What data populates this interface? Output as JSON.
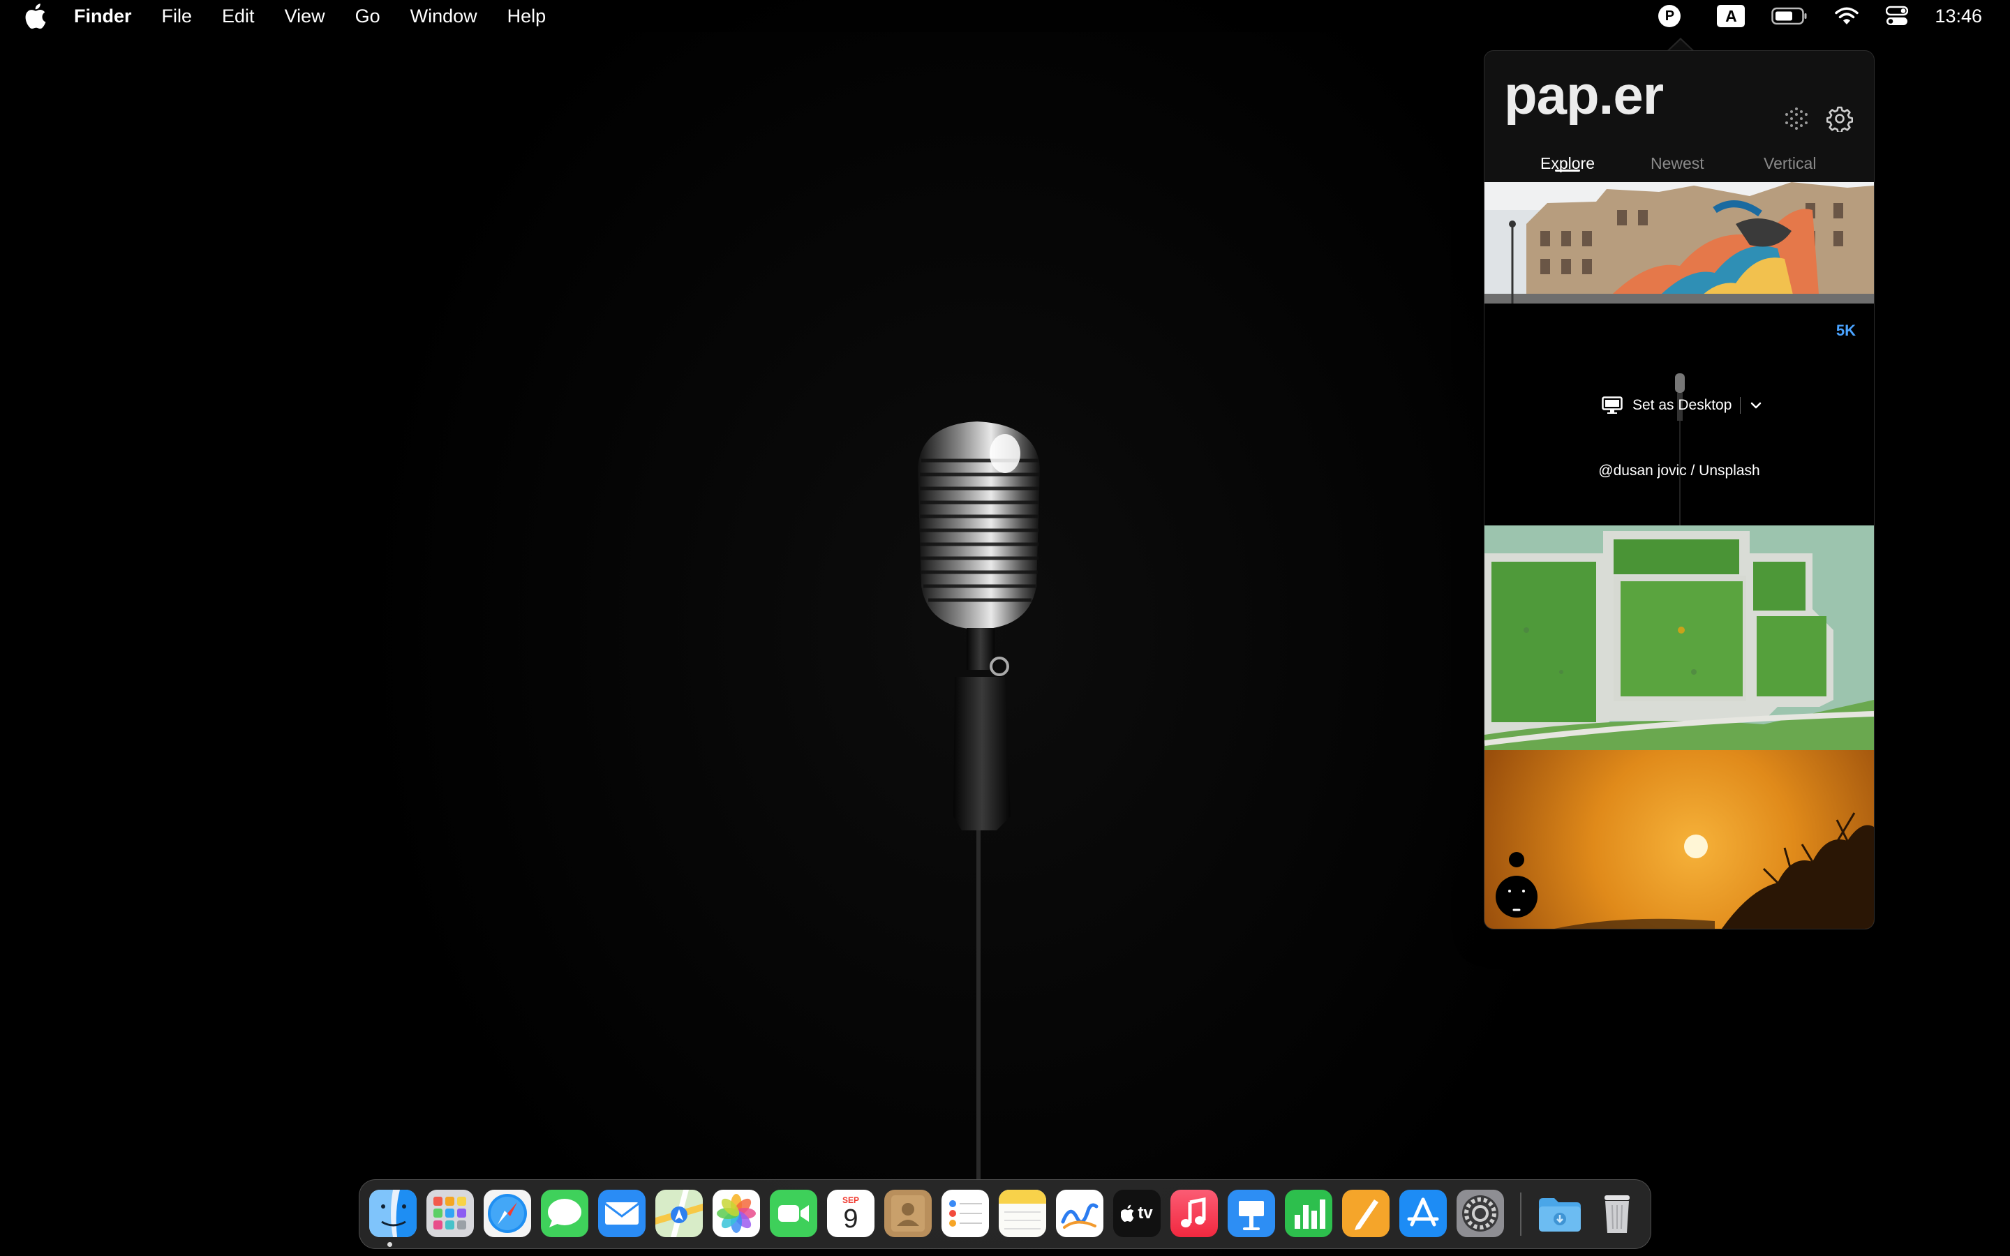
{
  "menubar": {
    "app_name": "Finder",
    "menus": [
      "File",
      "Edit",
      "View",
      "Go",
      "Window",
      "Help"
    ],
    "status": {
      "paper_letter": "P",
      "input_source": "A",
      "time": "13:46"
    },
    "icons": [
      "apple-icon",
      "paper-status-icon",
      "input-source-icon",
      "battery-icon",
      "wifi-icon",
      "control-center-icon"
    ]
  },
  "popover": {
    "logo": "pap.er",
    "tabs": [
      {
        "label": "Explore",
        "active": true
      },
      {
        "label": "Newest",
        "active": false
      },
      {
        "label": "Vertical",
        "active": false
      }
    ],
    "selected_card": {
      "resolution": "5K",
      "set_desktop_label": "Set as Desktop",
      "credit": "@dusan jovic / Unsplash"
    },
    "thumbnails": [
      "painted-building",
      "selected-microphone",
      "aerial-green-courtyards",
      "orange-sunset"
    ]
  },
  "calendar": {
    "month": "SEP",
    "day": "9"
  },
  "dock": {
    "apps": [
      "Finder",
      "Launchpad",
      "Safari",
      "Messages",
      "Mail",
      "Maps",
      "Photos",
      "FaceTime",
      "Calendar",
      "Contacts",
      "Reminders",
      "Notes",
      "Freeform",
      "TV",
      "Music",
      "Keynote",
      "Numbers",
      "Pages",
      "App Store",
      "System Settings",
      "Downloads",
      "Trash"
    ],
    "tv_label": "tv"
  },
  "colors": {
    "accent_blue": "#4aa3ff",
    "popover_bg": "#111111",
    "sunset_orange": "#e08a1a"
  }
}
